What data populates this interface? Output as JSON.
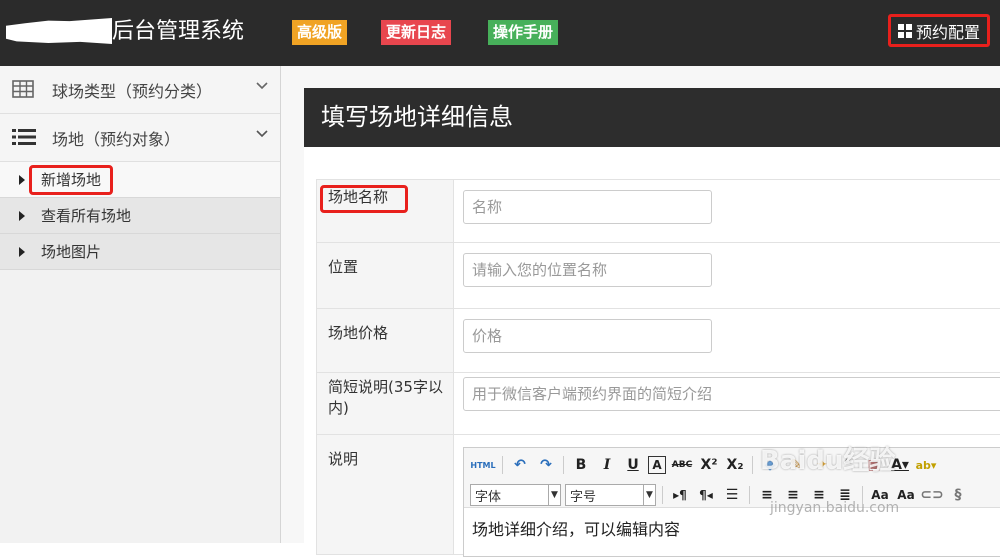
{
  "header": {
    "app_title": "后台管理系统",
    "badges": [
      "高级版",
      "更新日志",
      "操作手册"
    ],
    "config_button": "预约配置"
  },
  "sidebar": {
    "categories": [
      {
        "label": "球场类型（预约分类）"
      },
      {
        "label": "场地（预约对象）"
      }
    ],
    "sub_items": [
      {
        "label": "新增场地",
        "active": true
      },
      {
        "label": "查看所有场地"
      },
      {
        "label": "场地图片"
      }
    ]
  },
  "panel": {
    "title": "填写场地详细信息",
    "fields": [
      {
        "label": "场地名称",
        "placeholder": "名称"
      },
      {
        "label": "位置",
        "placeholder": "请输入您的位置名称"
      },
      {
        "label": "场地价格",
        "placeholder": "价格"
      },
      {
        "label": "简短说明(35字以内)",
        "placeholder": "用于微信客户端预约界面的简短介绍"
      },
      {
        "label": "说明"
      }
    ],
    "editor": {
      "font_select": "字体",
      "size_select": "字号",
      "content": "场地详细介绍，可以编辑内容"
    }
  },
  "watermark": {
    "logo": "Baidu经验",
    "url": "jingyan.baidu.com"
  },
  "colors": {
    "header_bg": "#2b2b2b",
    "badge_pro": "#f0a324",
    "badge_log": "#e8464e",
    "badge_manual": "#47b05a",
    "highlight": "#e8201c"
  }
}
